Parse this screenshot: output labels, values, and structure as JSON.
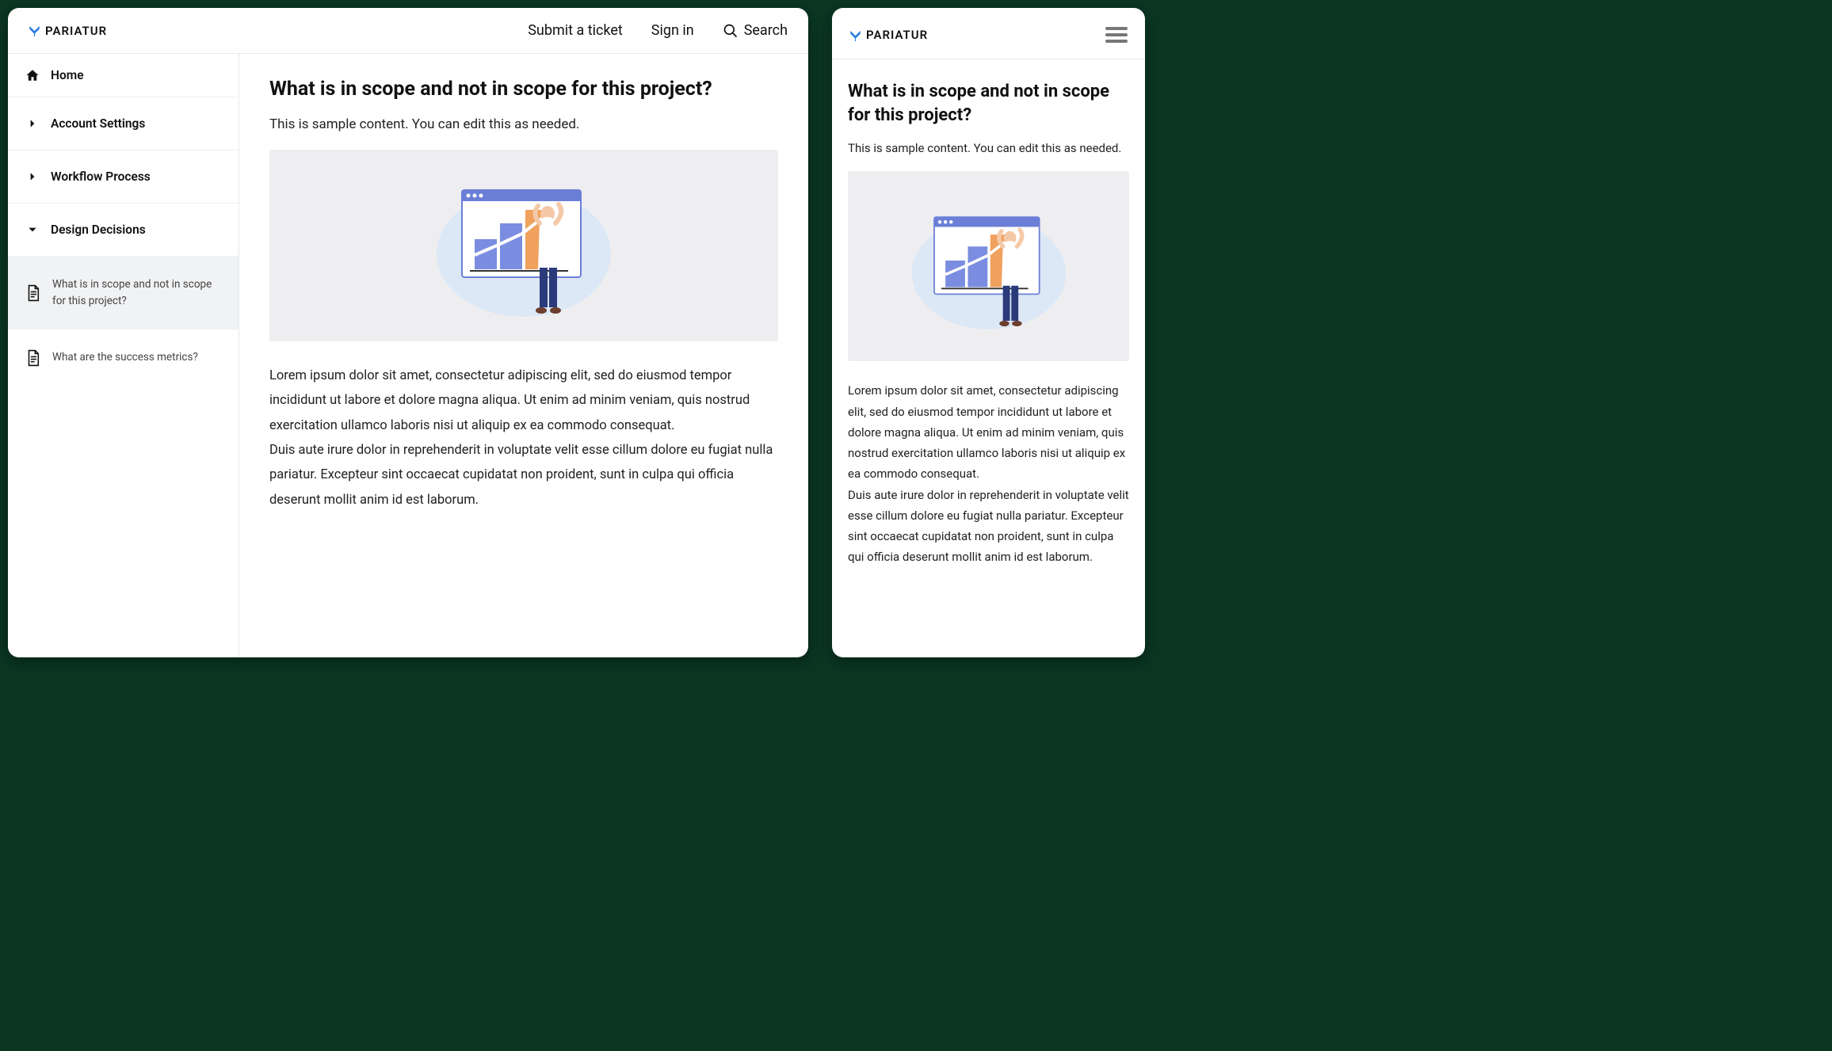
{
  "brand": {
    "name": "PARIATUR"
  },
  "header": {
    "submit_link": "Submit a ticket",
    "signin_link": "Sign in",
    "search_label": "Search"
  },
  "sidebar": {
    "items": [
      {
        "label": "Home",
        "icon": "home"
      },
      {
        "label": "Account Settings",
        "icon": "chevron-right"
      },
      {
        "label": "Workflow Process",
        "icon": "chevron-right"
      },
      {
        "label": "Design Decisions",
        "icon": "chevron-down",
        "expanded": true
      }
    ],
    "subitems": [
      {
        "label": "What is in scope and not in scope for this project?",
        "active": true
      },
      {
        "label": "What are the success metrics?",
        "active": false
      }
    ]
  },
  "article": {
    "title": "What is in scope and not in scope for this project?",
    "lead": "This is sample content. You can edit this as needed.",
    "para1": "Lorem ipsum dolor sit amet, consectetur adipiscing elit, sed do eiusmod tempor incididunt ut labore et dolore magna aliqua. Ut enim ad minim veniam, quis nostrud exercitation ullamco laboris nisi ut aliquip ex ea commodo consequat.",
    "para2": "Duis aute irure dolor in reprehenderit in voluptate velit esse cillum dolore eu fugiat nulla pariatur. Excepteur sint occaecat cupidatat non proident, sunt in culpa qui officia deserunt mollit anim id est laborum."
  }
}
